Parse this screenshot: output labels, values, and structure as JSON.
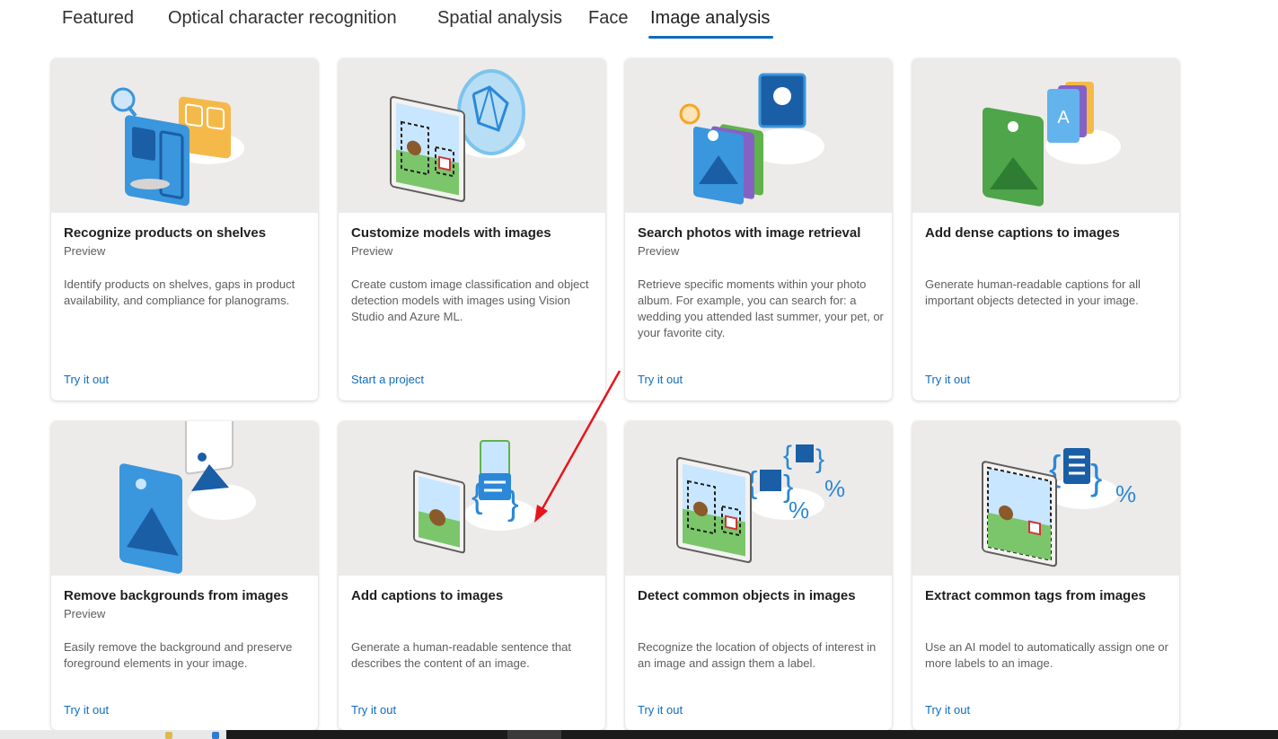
{
  "tabs": [
    {
      "label": "Featured"
    },
    {
      "label": "Optical character recognition"
    },
    {
      "label": "Spatial analysis"
    },
    {
      "label": "Face"
    },
    {
      "label": "Image analysis",
      "active": true
    }
  ],
  "cards": [
    {
      "title": "Recognize products on shelves",
      "badge": "Preview",
      "description": "Identify products on shelves, gaps in product availability, and compliance for planograms.",
      "link": "Try it out",
      "icon": "product-shelf-icon"
    },
    {
      "title": "Customize models with images",
      "badge": "Preview",
      "description": "Create custom image classification and object detection models with images using Vision Studio and Azure ML.",
      "link": "Start a project",
      "icon": "custom-model-icon"
    },
    {
      "title": "Search photos with image retrieval",
      "badge": "Preview",
      "description": "Retrieve specific moments within your photo album. For example, you can search for: a wedding you attended last summer, your pet, or your favorite city.",
      "link": "Try it out",
      "icon": "photo-search-icon"
    },
    {
      "title": "Add dense captions to images",
      "badge": "",
      "description": "Generate human-readable captions for all important objects detected in your image.",
      "link": "Try it out",
      "icon": "dense-captions-icon"
    },
    {
      "title": "Remove backgrounds from images",
      "badge": "Preview",
      "description": "Easily remove the background and preserve foreground elements in your image.",
      "link": "Try it out",
      "icon": "remove-background-icon"
    },
    {
      "title": "Add captions to images",
      "badge": "",
      "description": "Generate a human-readable sentence that describes the content of an image.",
      "link": "Try it out",
      "icon": "captions-icon"
    },
    {
      "title": "Detect common objects in images",
      "badge": "",
      "description": "Recognize the location of objects of interest in an image and assign them a label.",
      "link": "Try it out",
      "icon": "object-detection-icon"
    },
    {
      "title": "Extract common tags from images",
      "badge": "",
      "description": "Use an AI model to automatically assign one or more labels to an image.",
      "link": "Try it out",
      "icon": "tags-icon"
    }
  ],
  "colors": {
    "accent": "#0f6cbd",
    "art_background": "#edebe9",
    "annotation_arrow": "#e8141c"
  }
}
